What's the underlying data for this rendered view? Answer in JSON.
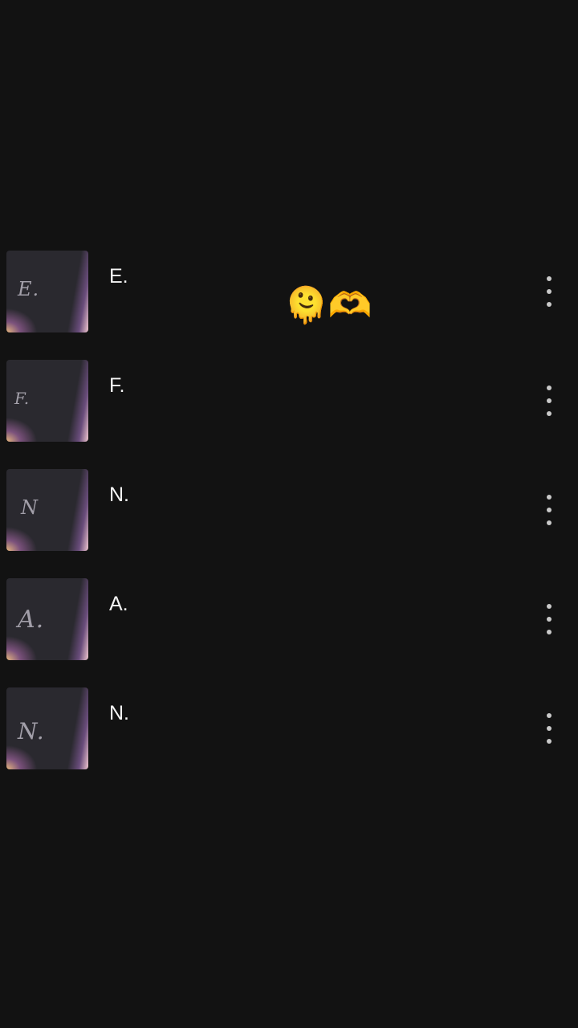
{
  "items": [
    {
      "title": "E.",
      "thumb_text": "E."
    },
    {
      "title": "F.",
      "thumb_text": "F."
    },
    {
      "title": "N.",
      "thumb_text": "N"
    },
    {
      "title": "A.",
      "thumb_text": "A."
    },
    {
      "title": "N.",
      "thumb_text": "N."
    }
  ],
  "overlay": {
    "emoji": "🫠🫶"
  },
  "colors": {
    "background": "#121212",
    "text": "#f4f4f4",
    "menu_dots": "#c9c9c9"
  }
}
